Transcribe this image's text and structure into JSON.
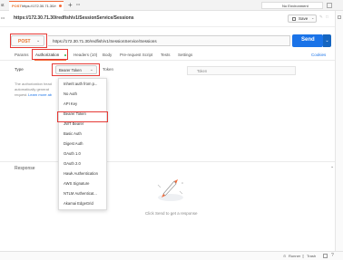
{
  "tabbar": {
    "left_fragment": "st",
    "tab_method": "POST",
    "tab_url": "https://172.30.71.30/r",
    "new_tab": "+",
    "more": "•••",
    "environment": "No Environment"
  },
  "title_row": {
    "prefix": "•••",
    "title": "https://172.30.71.30/redfish/v1/SessionService/Sessions",
    "save_label": "Save",
    "right_fragment": "</>"
  },
  "request": {
    "method": "POST",
    "url": "https://172.30.71.30/redfish/v1/SessionService/Sessions",
    "send_label": "Send"
  },
  "subtabs": {
    "params": "Params",
    "authorization": "Authorization",
    "headers": "Headers (10)",
    "body": "Body",
    "pre_request": "Pre-request Script",
    "tests": "Tests",
    "settings": "Settings",
    "cookies": "Cookies"
  },
  "auth": {
    "type_label": "Type",
    "selected": "Bearer Token",
    "token_label": "Token",
    "token_placeholder": "Token",
    "description_1": "The authorization head",
    "description_2": "automatically generat",
    "description_3": "request.",
    "learn_more": "Learn more ab"
  },
  "dropdown": {
    "items": [
      "Inherit auth from p...",
      "No Auth",
      "API Key",
      "Bearer Token",
      "JWT Bearer",
      "Basic Auth",
      "Digest Auth",
      "OAuth 1.0",
      "OAuth 2.0",
      "Hawk Authentication",
      "AWS Signature",
      "NTLM Authenticat...",
      "Akamai EdgeGrid"
    ]
  },
  "response": {
    "label": "Response",
    "empty_text": "Click Send to get a response"
  },
  "bottombar": {
    "runner": "Runner",
    "trash": "Trash"
  },
  "colors": {
    "accent_blue": "#1a73e8",
    "highlight_red": "#e53935",
    "method_orange": "#e8722a"
  }
}
